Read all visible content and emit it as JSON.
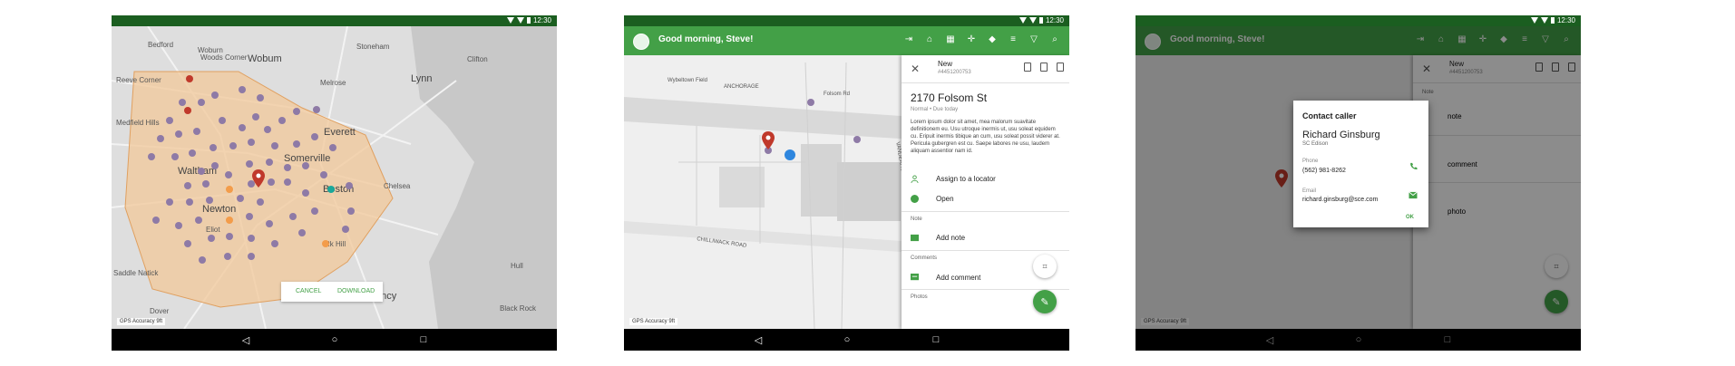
{
  "status_bar": {
    "time": "12:30"
  },
  "screen1": {
    "gps_label": "GPS Accuracy 9ft",
    "labels": [
      "Bedford",
      "Woburn",
      "Woods Corner",
      "Wobum",
      "Stoneham",
      "Clifton",
      "Reeve Corner",
      "Lynn",
      "Melrose",
      "Everett",
      "Waltham",
      "Somerville",
      "Boston",
      "Newton",
      "Chelsea",
      "Eliot",
      "Rk Hill",
      "Medfield Hills",
      "Dover",
      "Quincy",
      "Black Rock",
      "Hull",
      "Saddle Natick"
    ],
    "dialog": {
      "cancel": "CANCEL",
      "download": "DOWNLOAD"
    },
    "colors": {
      "polygon": "#f2c89a",
      "dot": "#8e7aa6",
      "red_pin": "#c0392b",
      "orange": "#f39c4a",
      "teal": "#1aa89a"
    }
  },
  "screen2": {
    "greeting": "Good morning, Steve!",
    "gps_label": "GPS Accuracy 9ft",
    "panel": {
      "title": "New",
      "ticket": "#4451200753",
      "address": "2170 Folsom St",
      "priority": "Normal",
      "due": "Due today",
      "description": "Lorem ipsum dolor sit amet, mea malorum suavitate definitionem eu. Usu utroque inermis ut, usu soleat equidem cu. Eripuit inermis tibique an cum, usu soleat possit viderer at. Pericula gubergren est cu. Saepe labores ne usu, laudem aliquam assentior nam id.",
      "assign": "Assign to a locator",
      "status": "Open",
      "note_section": "Note",
      "add_note": "Add note",
      "comments_section": "Comments",
      "add_comment": "Add comment",
      "photos_section": "Photos"
    },
    "map_labels": [
      "Wybeltown Field",
      "ANCHORAGE",
      "Folsom Rd",
      "VANDERHOOF ST",
      "CHILLIWACK ROAD"
    ]
  },
  "screen3": {
    "greeting": "Good morning, Steve!",
    "gps_label": "GPS Accuracy 9ft",
    "panel_partial": {
      "title": "New",
      "ticket": "#4451200753",
      "note_section": "Note",
      "note": "note",
      "comment": "comment",
      "photo": "photo"
    },
    "dialog": {
      "title": "Contact caller",
      "name": "Richard Ginsburg",
      "company": "SC Edison",
      "phone_label": "Phone",
      "phone": "(562) 981-8262",
      "email_label": "Email",
      "email": "richard.ginsburg@sce.com",
      "ok": "OK"
    }
  }
}
